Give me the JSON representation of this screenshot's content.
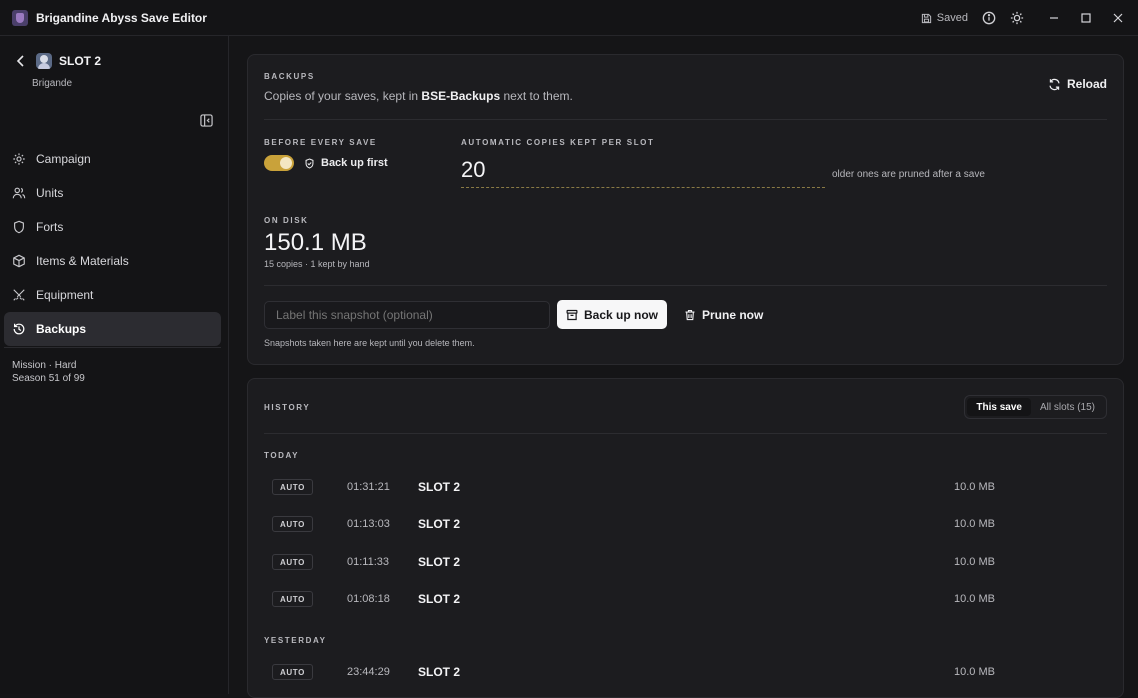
{
  "window": {
    "title": "Brigandine Abyss Save Editor",
    "saved_label": "Saved"
  },
  "sidebar": {
    "slot_title": "SLOT 2",
    "slot_subtitle": "Brigande",
    "items": [
      {
        "label": "Campaign",
        "icon": "gear-icon"
      },
      {
        "label": "Units",
        "icon": "users-icon"
      },
      {
        "label": "Forts",
        "icon": "shield-icon"
      },
      {
        "label": "Items & Materials",
        "icon": "box-icon"
      },
      {
        "label": "Equipment",
        "icon": "swords-icon"
      },
      {
        "label": "Backups",
        "icon": "history-icon",
        "active": true
      }
    ],
    "meta_line1": "Mission · Hard",
    "meta_line2": "Season 51 of 99"
  },
  "backups": {
    "overline": "BACKUPS",
    "desc_prefix": "Copies of your saves, kept in",
    "desc_folder": "BSE-Backups",
    "desc_suffix": "next to them.",
    "reload_label": "Reload",
    "before_every_save_label": "BEFORE EVERY SAVE",
    "backup_first_label": "Back up first",
    "backup_first_enabled": true,
    "auto_copies_label": "AUTOMATIC COPIES KEPT PER SLOT",
    "auto_copies_value": "20",
    "auto_copies_hint": "older ones are pruned after a save",
    "on_disk_label": "ON DISK",
    "on_disk_size": "150.1 MB",
    "on_disk_detail": "15 copies · 1 kept by hand",
    "snapshot_placeholder": "Label this snapshot (optional)",
    "backup_now_label": "Back up now",
    "prune_now_label": "Prune now",
    "snapshot_note": "Snapshots taken here are kept until you delete them."
  },
  "history": {
    "overline": "HISTORY",
    "tab_this_save": "This save",
    "tab_all_slots": "All slots (15)",
    "today_label": "TODAY",
    "yesterday_label": "YESTERDAY",
    "today": [
      {
        "badge": "AUTO",
        "time": "01:31:21",
        "slot": "SLOT 2",
        "size": "10.0 MB"
      },
      {
        "badge": "AUTO",
        "time": "01:13:03",
        "slot": "SLOT 2",
        "size": "10.0 MB"
      },
      {
        "badge": "AUTO",
        "time": "01:11:33",
        "slot": "SLOT 2",
        "size": "10.0 MB"
      },
      {
        "badge": "AUTO",
        "time": "01:08:18",
        "slot": "SLOT 2",
        "size": "10.0 MB"
      }
    ],
    "yesterday": [
      {
        "badge": "AUTO",
        "time": "23:44:29",
        "slot": "SLOT 2",
        "size": "10.0 MB"
      }
    ]
  },
  "colors": {
    "accent": "#c9a23a",
    "background": "#151517",
    "card": "#1c1c1f"
  }
}
